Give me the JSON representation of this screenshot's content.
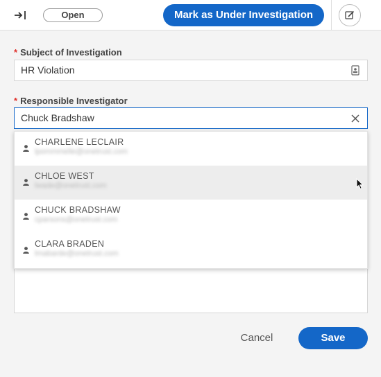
{
  "header": {
    "status": "Open",
    "primary_action": "Mark as Under Investigation"
  },
  "form": {
    "subject": {
      "label": "Subject of Investigation",
      "value": "HR Violation"
    },
    "investigator": {
      "label": "Responsible Investigator",
      "value": "Chuck Bradshaw"
    }
  },
  "dropdown": {
    "options": [
      {
        "name": "CHARLENE LECLAIR",
        "email": "lpommmelle@onetrust.com"
      },
      {
        "name": "CHLOE WEST",
        "email": "lwade@onetrust.com"
      },
      {
        "name": "CHUCK BRADSHAW",
        "email": "cparsons@onetrust.com"
      },
      {
        "name": "CLARA BRADEN",
        "email": "lmabarde@onetrust.com"
      }
    ],
    "hovered_index": 1
  },
  "footer": {
    "cancel_label": "Cancel",
    "save_label": "Save"
  },
  "colors": {
    "primary": "#1467c8",
    "required": "#e0312c"
  },
  "icons": {
    "collapse": "arrow-to-bar-icon",
    "edit": "edit-icon",
    "lookup": "contact-card-icon",
    "clear": "close-icon",
    "person": "person-icon",
    "cursor": "mouse-cursor-icon"
  }
}
